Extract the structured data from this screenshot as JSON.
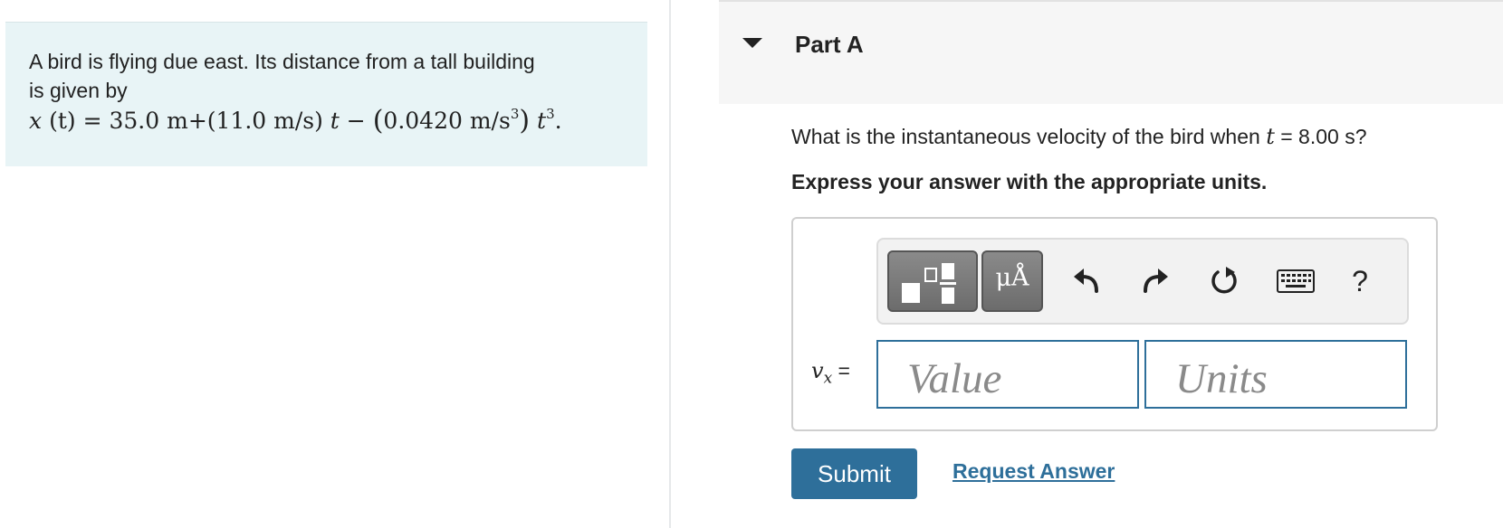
{
  "problem": {
    "line1": "A bird is flying due east. Its distance from a tall building",
    "line2": "is given by",
    "formula": {
      "lhs_var": "x",
      "lhs_arg": "(t)",
      "eq": "=",
      "term1": "35.0 m",
      "plus": "+",
      "term2": "(11.0 m/s)",
      "t1": "t",
      "minus": "−",
      "term3_open": "(",
      "term3_body": "0.0420 m/s",
      "term3_exp": "3",
      "term3_close": ")",
      "t2": "t",
      "t2_exp": "3",
      "period": "."
    }
  },
  "part": {
    "title": "Part A"
  },
  "question": {
    "before": "What is the instantaneous velocity of the bird when",
    "var": "t",
    "after": "= 8.00 s?"
  },
  "instruction": "Express your answer with the appropriate units.",
  "toolbar": {
    "units_label": "μÅ",
    "help_label": "?",
    "icons": [
      "fraction-template-icon",
      "units-icon",
      "undo-icon",
      "redo-icon",
      "reset-icon",
      "keyboard-icon",
      "help-icon"
    ]
  },
  "answer": {
    "var": "v",
    "sub": "x",
    "eq": "=",
    "value_placeholder": "Value",
    "units_placeholder": "Units"
  },
  "actions": {
    "submit": "Submit",
    "request": "Request Answer"
  },
  "colors": {
    "primary": "#2e6f9a",
    "problem_bg": "#e8f4f6",
    "header_bg": "#f6f6f6"
  }
}
